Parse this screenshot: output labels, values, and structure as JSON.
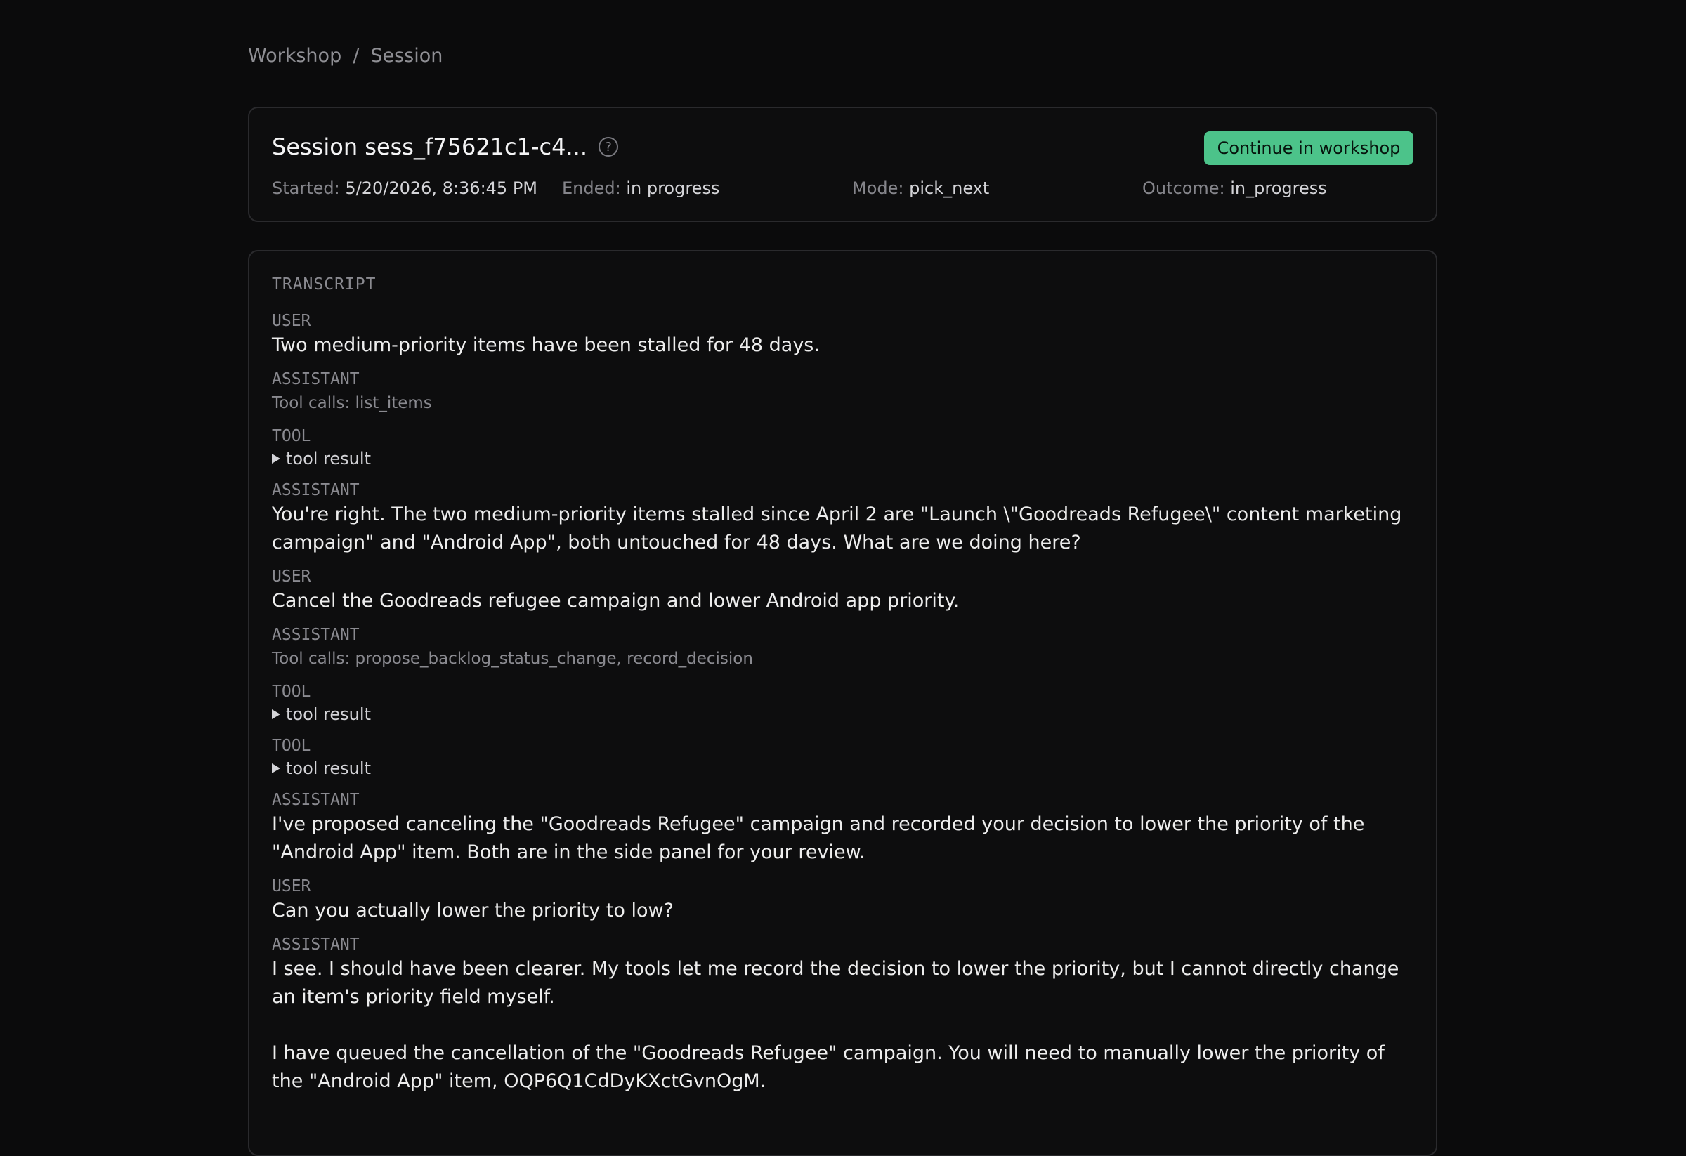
{
  "breadcrumb": {
    "root": "Workshop",
    "separator": "/",
    "current": "Session"
  },
  "session": {
    "title": "Session sess_f75621c1-c4...",
    "help_icon": "question-circle-icon",
    "continue_label": "Continue in workshop",
    "started_label": "Started:",
    "started_value": "5/20/2026, 8:36:45 PM",
    "ended_label": "Ended:",
    "ended_value": "in progress",
    "mode_label": "Mode:",
    "mode_value": "pick_next",
    "outcome_label": "Outcome:",
    "outcome_value": "in_progress"
  },
  "transcript": {
    "heading": "TRANSCRIPT",
    "messages": [
      {
        "role": "USER",
        "kind": "text",
        "text": "Two medium-priority items have been stalled for 48 days."
      },
      {
        "role": "ASSISTANT",
        "kind": "toolcalls",
        "text": "Tool calls: list_items"
      },
      {
        "role": "TOOL",
        "kind": "result",
        "text": "tool result"
      },
      {
        "role": "ASSISTANT",
        "kind": "text",
        "text": "You're right. The two medium-priority items stalled since April 2 are \"Launch \\\"Goodreads Refugee\\\" content marketing campaign\" and \"Android App\", both untouched for 48 days. What are we doing here?"
      },
      {
        "role": "USER",
        "kind": "text",
        "text": "Cancel the Goodreads refugee campaign and lower Android app priority."
      },
      {
        "role": "ASSISTANT",
        "kind": "toolcalls",
        "text": "Tool calls: propose_backlog_status_change, record_decision"
      },
      {
        "role": "TOOL",
        "kind": "result",
        "text": "tool result"
      },
      {
        "role": "TOOL",
        "kind": "result",
        "text": "tool result"
      },
      {
        "role": "ASSISTANT",
        "kind": "text",
        "text": "I've proposed canceling the \"Goodreads Refugee\" campaign and recorded your decision to lower the priority of the \"Android App\" item. Both are in the side panel for your review."
      },
      {
        "role": "USER",
        "kind": "text",
        "text": "Can you actually lower the priority to low?"
      },
      {
        "role": "ASSISTANT",
        "kind": "text",
        "text": "I see. I should have been clearer. My tools let me record the decision to lower the priority, but I cannot directly change an item's priority field myself.\n\nI have queued the cancellation of the \"Goodreads Refugee\" campaign. You will need to manually lower the priority of the \"Android App\" item, OQP6Q1CdDyKXctGvnOgM."
      }
    ]
  },
  "colors": {
    "background": "#0b0b0c",
    "accent": "#4cc38a",
    "border": "#2a2a2d"
  }
}
